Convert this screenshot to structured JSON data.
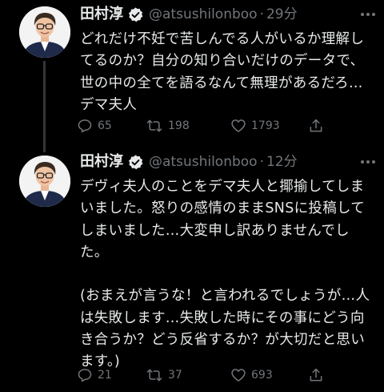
{
  "colors": {
    "background": "#000000",
    "text_primary": "#e7e9ea",
    "text_secondary": "#71767b",
    "verified_badge": "#e7e9ea",
    "thread_line": "#333639"
  },
  "tweets": [
    {
      "display_name": "田村淳",
      "verified_icon": "verified-badge-icon",
      "handle": "@atsushilonboo",
      "separator": "·",
      "time": "29分",
      "text": "どれだけ不妊で苦しんでる人がいるか理解してるのか？自分の知り合いだけのデータで、世の中の全てを語るなんて無理があるだろ…デマ夫人",
      "reply_count": "65",
      "retweet_count": "198",
      "like_count": "1793",
      "icons": [
        "reply-icon",
        "retweet-icon",
        "like-icon",
        "share-icon"
      ]
    },
    {
      "display_name": "田村淳",
      "verified_icon": "verified-badge-icon",
      "handle": "@atsushilonboo",
      "separator": "·",
      "time": "12分",
      "text": "デヴィ夫人のことをデマ夫人と揶揄してしまいました。怒りの感情のままSNSに投稿してしまいました…大変申し訳ありませんでした。\n\n(おまえが言うな！と言われるでしょうが…人は失敗します…失敗した時にその事にどう向き合うか？どう反省するか？が大切だと思います。)",
      "reply_count": "21",
      "retweet_count": "37",
      "like_count": "693",
      "icons": [
        "reply-icon",
        "retweet-icon",
        "like-icon",
        "share-icon"
      ]
    }
  ]
}
